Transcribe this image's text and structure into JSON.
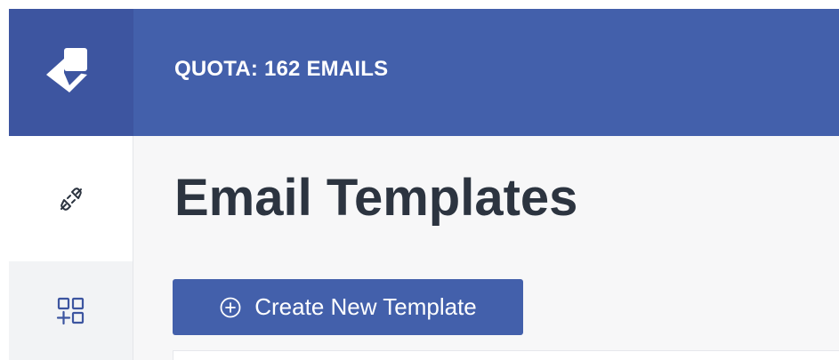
{
  "header": {
    "logo_icon": "brand-logo-icon",
    "quota_text": "QUOTA: 162 EMAILS"
  },
  "sidebar": {
    "items": [
      {
        "icon": "plug-connect-icon",
        "active": false
      },
      {
        "icon": "add-apps-grid-icon",
        "active": true
      }
    ]
  },
  "main": {
    "title": "Email Templates",
    "create_button": {
      "icon": "plus-circle-icon",
      "label": "Create New Template"
    }
  },
  "colors": {
    "brand_blue": "#4360ab",
    "logo_cell": "#3d55a0",
    "title_text": "#2c3440",
    "content_background": "#f7f7f8"
  }
}
